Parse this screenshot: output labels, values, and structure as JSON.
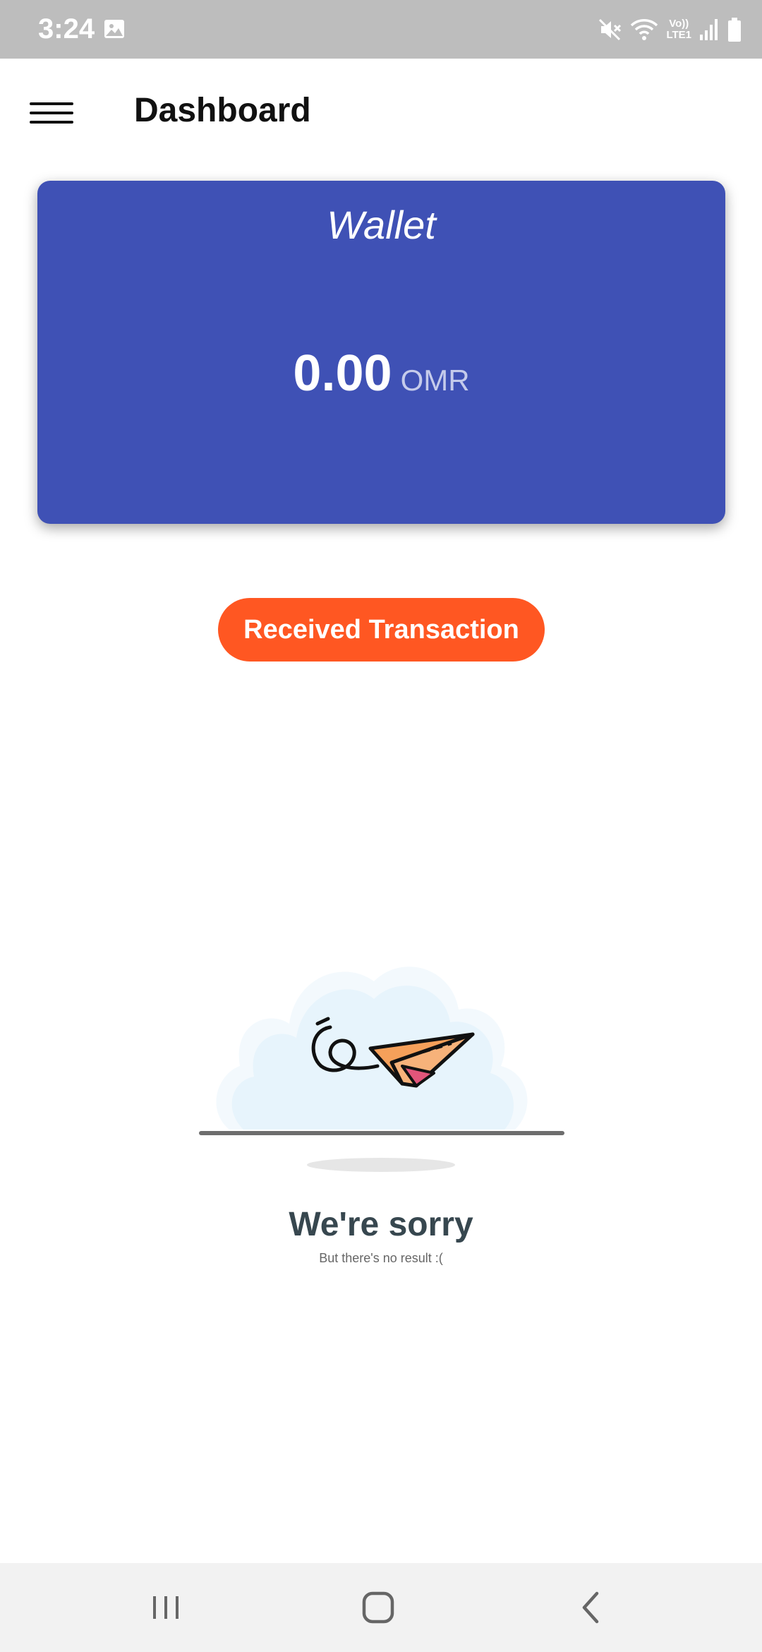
{
  "status_bar": {
    "time": "3:24",
    "lte_top": "Vo))",
    "lte_bottom": "LTE1",
    "icons": [
      "gallery-icon",
      "mute-icon",
      "wifi-icon",
      "signal-icon",
      "battery-icon"
    ]
  },
  "app_bar": {
    "title": "Dashboard",
    "menu_icon": "hamburger-icon"
  },
  "wallet": {
    "title": "Wallet",
    "balance": "0.00",
    "currency": "OMR",
    "card_color": "#3f51b5"
  },
  "actions": {
    "received_label": "Received Transaction",
    "accent_color": "#ff5722"
  },
  "empty_state": {
    "title": "We're sorry",
    "subtitle": "But there's no result :(",
    "illustration": "paper-plane-icon"
  },
  "nav_bar": {
    "icons": [
      "recent-apps-icon",
      "home-icon",
      "back-icon"
    ]
  }
}
